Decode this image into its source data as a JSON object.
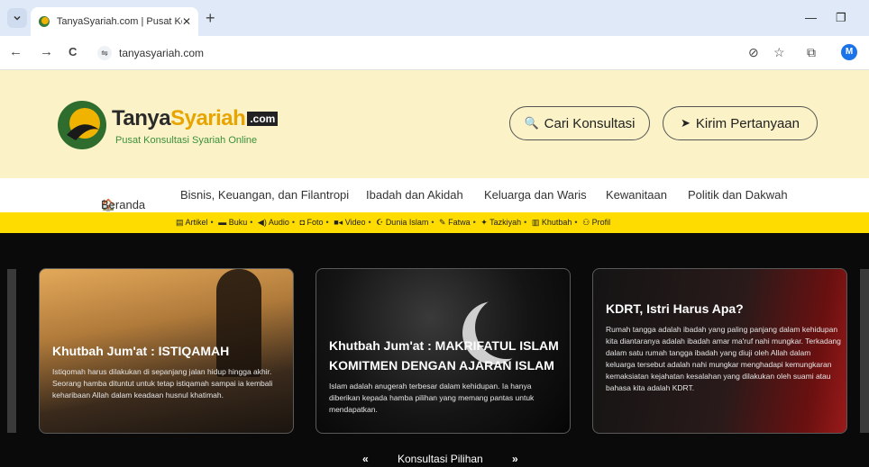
{
  "browser": {
    "tab_title": "TanyaSyariah.com | Pusat Konsu",
    "tab_close": "✕",
    "new_tab": "+",
    "url": "tanyasyariah.com",
    "profile_initial": "M",
    "minimize": "—",
    "restore": "❐",
    "back": "←",
    "forward": "→",
    "reload": "C",
    "site_info": "⇋",
    "eye_off": "⊘",
    "star": "☆",
    "extensions": "⧉"
  },
  "header": {
    "logo_text_1": "Tanya",
    "logo_text_2": "Syariah",
    "logo_com": ".com",
    "logo_tagline": "Pusat Konsultasi Syariah Online",
    "search_button": "Cari Konsultasi",
    "ask_button": "Kirim Pertanyaan",
    "search_icon": "🔍",
    "send_icon": "➤"
  },
  "main_nav": [
    {
      "label": "Beranda",
      "icon": "🏠"
    },
    {
      "label": "Bisnis, Keuangan, dan Filantropi"
    },
    {
      "label": "Ibadah dan Akidah"
    },
    {
      "label": "Keluarga dan Waris"
    },
    {
      "label": "Kewanitaan"
    },
    {
      "label": "Politik dan Dakwah"
    }
  ],
  "sub_nav": [
    {
      "label": "Artikel",
      "icon": "▤"
    },
    {
      "label": "Buku",
      "icon": "▬"
    },
    {
      "label": "Audio",
      "icon": "◀)"
    },
    {
      "label": "Foto",
      "icon": "◘"
    },
    {
      "label": "Video",
      "icon": "■◂"
    },
    {
      "label": "Dunia Islam",
      "icon": "☪"
    },
    {
      "label": "Fatwa",
      "icon": "✎"
    },
    {
      "label": "Tazkiyah",
      "icon": "✦"
    },
    {
      "label": "Khutbah",
      "icon": "▥"
    },
    {
      "label": "Profil",
      "icon": "⚇"
    }
  ],
  "cards": [
    {
      "title": "Khutbah Jum'at : ISTIQAMAH",
      "body": "Istiqomah harus dilakukan di sepanjang jalan hidup hingga akhir. Seorang hamba dituntut untuk tetap istiqamah sampai ia kembali keharibaan Allah dalam keadaan husnul khatimah."
    },
    {
      "title": "Khutbah Jum'at : MAKRIFATUL ISLAM KOMITMEN DENGAN AJARAN ISLAM",
      "body": "Islam adalah anugerah terbesar dalam kehidupan. Ia hanya diberikan kepada hamba pilihan yang memang pantas untuk mendapatkan."
    },
    {
      "title": "KDRT, Istri Harus Apa?",
      "body": "Rumah tangga adalah ibadah yang paling panjang dalam kehidupan kita diantaranya adalah ibadah amar ma'ruf nahi mungkar. Terkadang dalam satu rumah tangga ibadah yang diuji oleh Allah dalam keluarga tersebut adalah nahi mungkar menghadapi kemungkaran kemaksiatan kejahatan kesalahan yang dilakukan oleh suami atau bahasa kita adalah KDRT."
    }
  ],
  "pager": {
    "prev": "«",
    "label": "Konsultasi Pilihan",
    "next": "»"
  }
}
